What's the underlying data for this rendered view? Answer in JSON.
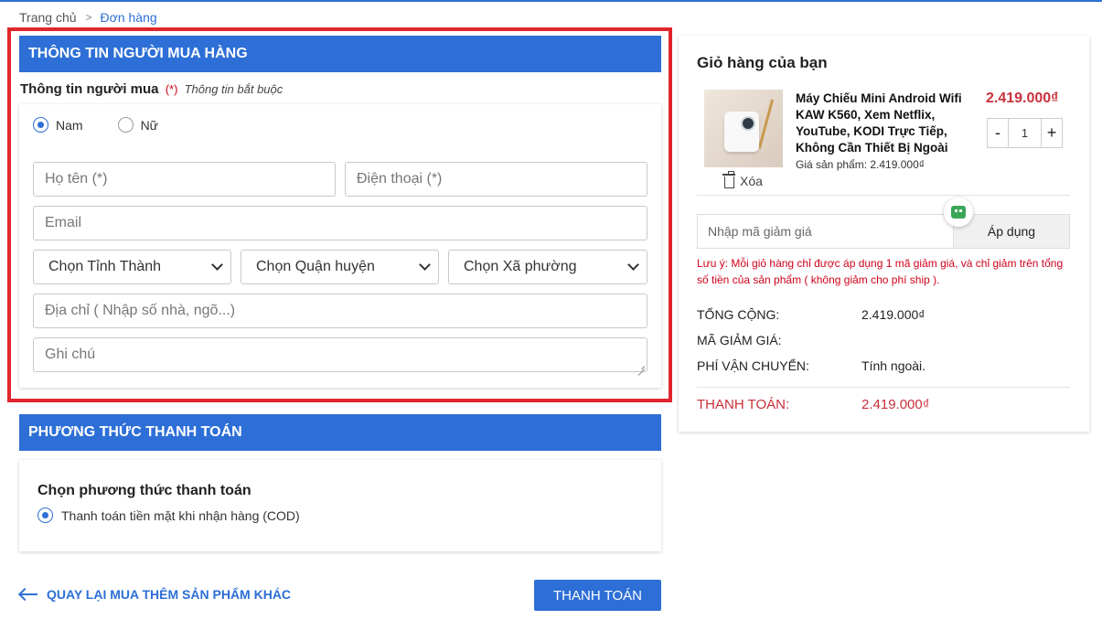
{
  "breadcrumb": {
    "home": "Trang chủ",
    "current": "Đơn hàng"
  },
  "buyer": {
    "section_title": "THÔNG TIN NGƯỜI MUA HÀNG",
    "subtitle": "Thông tin người mua",
    "required_mark": "(*)",
    "required_note": "Thông tin bắt buộc",
    "gender": {
      "male": "Nam",
      "female": "Nữ",
      "selected": "Nam"
    },
    "fields": {
      "name_placeholder": "Họ tên (*)",
      "phone_placeholder": "Điện thoại (*)",
      "email_placeholder": "Email",
      "province": "Chọn Tỉnh Thành",
      "district": "Chọn Quận huyện",
      "ward": "Chọn Xã phường",
      "address_placeholder": "Địa chỉ ( Nhập số nhà, ngõ...)",
      "note_placeholder": "Ghi chú"
    }
  },
  "payment": {
    "section_title": "PHƯƠNG THỨC THANH TOÁN",
    "choose_title": "Chọn phương thức thanh toán",
    "option_cod": "Thanh toán tiền mặt khi nhận hàng (COD)"
  },
  "footer": {
    "back_link": "QUAY LẠI MUA THÊM SẢN PHẨM KHÁC",
    "pay_button": "THANH TOÁN"
  },
  "cart": {
    "title": "Giỏ hàng của bạn",
    "item": {
      "name": "Máy Chiếu Mini Android Wifi KAW K560, Xem Netflix, YouTube, KODI Trực Tiếp, Không Cần Thiết Bị Ngoài",
      "price": "2.419.000₫",
      "price_note": "Giá sản phẩm: 2.419.000₫",
      "qty": "1",
      "minus": "-",
      "plus": "+",
      "remove": "Xóa"
    },
    "coupon_placeholder": "Nhập mã giảm giá",
    "coupon_apply": "Áp dụng",
    "coupon_note": "Lưu ý: Mỗi giỏ hàng chỉ được áp dụng 1 mã giảm giá, và chỉ giảm trên tổng số tiền của sản phẩm ( không giảm cho phí ship ).",
    "summary": {
      "total_label": "TỔNG CỘNG:",
      "total_value": "2.419.000₫",
      "discount_label": "MÃ GIẢM GIÁ:",
      "discount_value": "",
      "shipping_label": "PHÍ VẬN CHUYỂN:",
      "shipping_value": "Tính ngoài.",
      "pay_label": "THANH TOÁN:",
      "pay_value": "2.419.000₫"
    }
  },
  "colors": {
    "primary": "#2d6fd6",
    "highlight_border": "#e0262c",
    "price": "#c8303a",
    "note_red": "#d0021b"
  }
}
